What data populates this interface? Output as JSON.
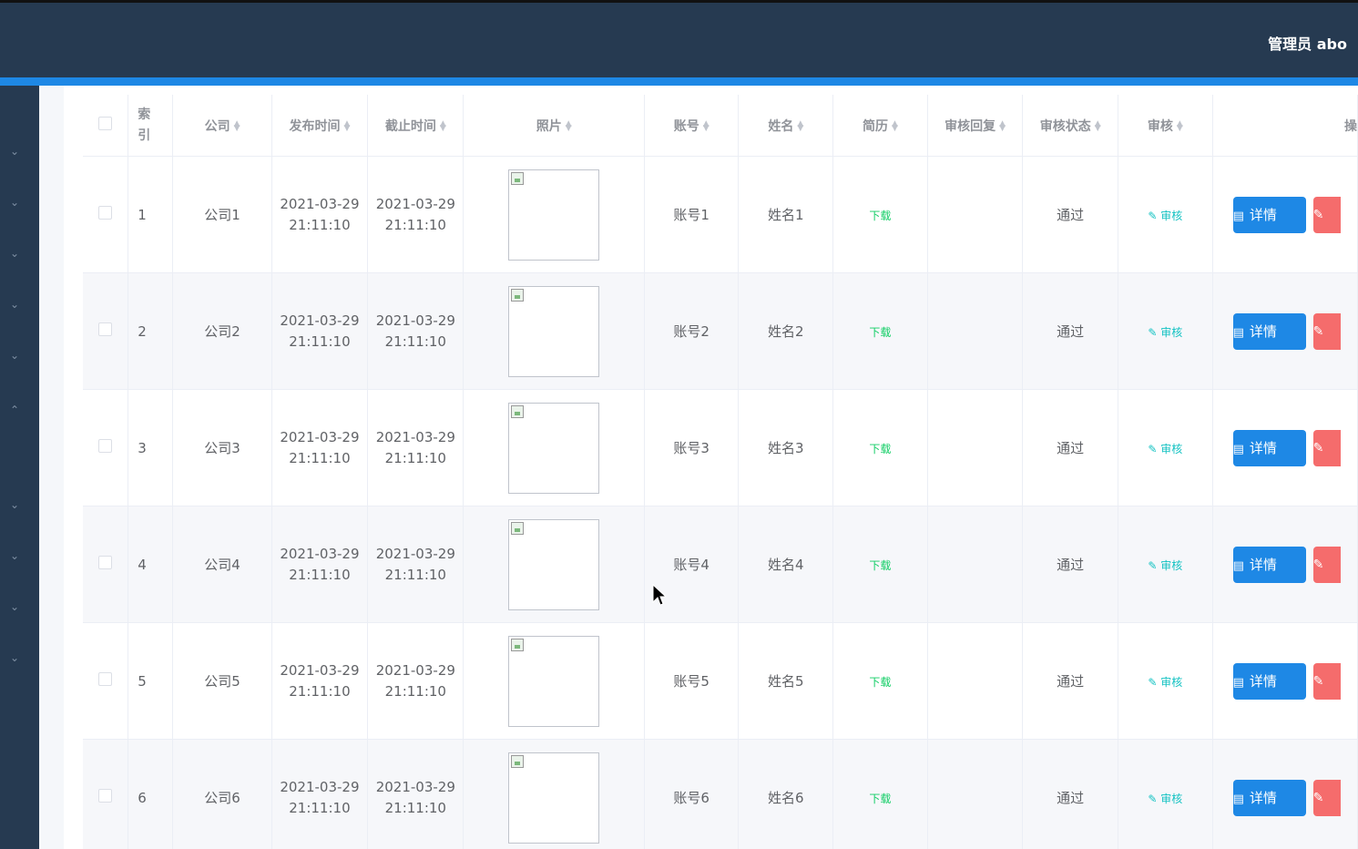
{
  "header": {
    "user_label": "管理员 abo"
  },
  "table": {
    "columns": {
      "index": "索\n引",
      "company": "公司",
      "publish_time": "发布时间",
      "deadline": "截止时间",
      "photo": "照片",
      "account": "账号",
      "name": "姓名",
      "resume": "简历",
      "review_reply": "审核回复",
      "review_status": "审核状态",
      "review": "审核",
      "ops": "操"
    },
    "rows": [
      {
        "index": "1",
        "company": "公司1",
        "publish_date": "2021-03-29",
        "publish_clock": "21:11:10",
        "deadline_date": "2021-03-29",
        "deadline_clock": "21:11:10",
        "account": "账号1",
        "name": "姓名1",
        "resume": "下载",
        "review_reply": "",
        "review_status": "通过",
        "review": "审核",
        "detail": "详情"
      },
      {
        "index": "2",
        "company": "公司2",
        "publish_date": "2021-03-29",
        "publish_clock": "21:11:10",
        "deadline_date": "2021-03-29",
        "deadline_clock": "21:11:10",
        "account": "账号2",
        "name": "姓名2",
        "resume": "下载",
        "review_reply": "",
        "review_status": "通过",
        "review": "审核",
        "detail": "详情"
      },
      {
        "index": "3",
        "company": "公司3",
        "publish_date": "2021-03-29",
        "publish_clock": "21:11:10",
        "deadline_date": "2021-03-29",
        "deadline_clock": "21:11:10",
        "account": "账号3",
        "name": "姓名3",
        "resume": "下载",
        "review_reply": "",
        "review_status": "通过",
        "review": "审核",
        "detail": "详情"
      },
      {
        "index": "4",
        "company": "公司4",
        "publish_date": "2021-03-29",
        "publish_clock": "21:11:10",
        "deadline_date": "2021-03-29",
        "deadline_clock": "21:11:10",
        "account": "账号4",
        "name": "姓名4",
        "resume": "下载",
        "review_reply": "",
        "review_status": "通过",
        "review": "审核",
        "detail": "详情"
      },
      {
        "index": "5",
        "company": "公司5",
        "publish_date": "2021-03-29",
        "publish_clock": "21:11:10",
        "deadline_date": "2021-03-29",
        "deadline_clock": "21:11:10",
        "account": "账号5",
        "name": "姓名5",
        "resume": "下载",
        "review_reply": "",
        "review_status": "通过",
        "review": "审核",
        "detail": "详情"
      },
      {
        "index": "6",
        "company": "公司6",
        "publish_date": "2021-03-29",
        "publish_clock": "21:11:10",
        "deadline_date": "2021-03-29",
        "deadline_clock": "21:11:10",
        "account": "账号6",
        "name": "姓名6",
        "resume": "下载",
        "review_reply": "",
        "review_status": "通过",
        "review": "审核",
        "detail": "详情"
      }
    ]
  },
  "colors": {
    "topbar": "#263a51",
    "accent": "#1e88e5",
    "primary_button": "#1e88e5",
    "danger_button": "#f56c6c",
    "download": "#13ce66"
  }
}
